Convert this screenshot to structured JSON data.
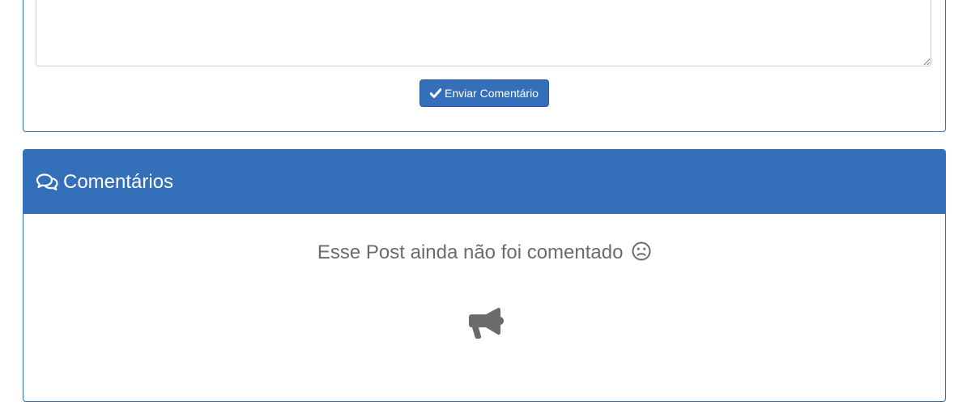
{
  "comment_form": {
    "textarea_value": "",
    "submit_label": "Enviar Comentário",
    "submit_icon": "check-icon"
  },
  "comments_panel": {
    "title": "Comentários",
    "title_icon": "comments-icon",
    "empty_message": "Esse Post ainda não foi comentado",
    "empty_icon": "frown-icon",
    "illustration_icon": "megaphone-icon"
  },
  "colors": {
    "primary": "#346fb9",
    "muted_text": "#6b6b6b"
  }
}
